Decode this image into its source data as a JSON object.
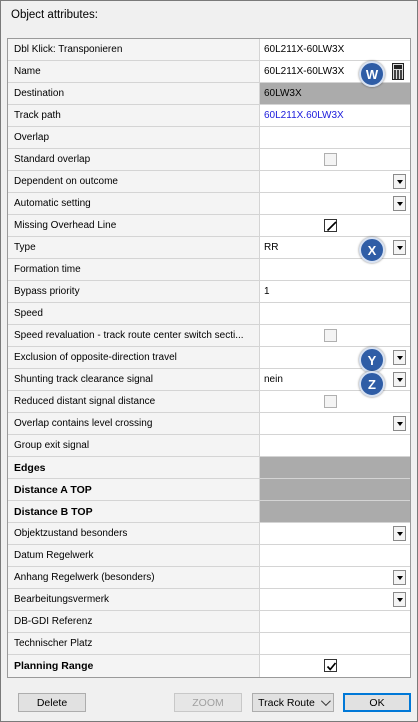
{
  "window": {
    "title": "Object attributes:"
  },
  "rows": [
    {
      "label": "Dbl Klick: Transponieren",
      "value": "60L211X-60LW3X"
    },
    {
      "label": "Name",
      "value": "60L211X-60LW3X"
    },
    {
      "label": "Destination",
      "value": "60LW3X"
    },
    {
      "label": "Track path",
      "value": "60L211X.60LW3X"
    },
    {
      "label": "Overlap",
      "value": ""
    },
    {
      "label": "Standard overlap",
      "value": ""
    },
    {
      "label": "Dependent on outcome",
      "value": ""
    },
    {
      "label": "Automatic setting",
      "value": ""
    },
    {
      "label": "Missing Overhead Line",
      "value": ""
    },
    {
      "label": "Type",
      "value": "RR"
    },
    {
      "label": "Formation time",
      "value": ""
    },
    {
      "label": "Bypass priority",
      "value": "1"
    },
    {
      "label": "Speed",
      "value": ""
    },
    {
      "label": "Speed revaluation - track route center switch secti...",
      "value": ""
    },
    {
      "label": "Exclusion of opposite-direction travel",
      "value": ""
    },
    {
      "label": "Shunting track clearance signal",
      "value": "nein"
    },
    {
      "label": "Reduced distant signal distance",
      "value": ""
    },
    {
      "label": "Overlap contains level crossing",
      "value": ""
    },
    {
      "label": "Group exit signal",
      "value": ""
    },
    {
      "label": "Edges",
      "value": ""
    },
    {
      "label": "Distance A TOP",
      "value": ""
    },
    {
      "label": "Distance B TOP",
      "value": ""
    },
    {
      "label": "Objektzustand besonders",
      "value": ""
    },
    {
      "label": "Datum Regelwerk",
      "value": ""
    },
    {
      "label": "Anhang Regelwerk (besonders)",
      "value": ""
    },
    {
      "label": "Bearbeitungsvermerk",
      "value": ""
    },
    {
      "label": "DB-GDI Referenz",
      "value": ""
    },
    {
      "label": "Technischer Platz",
      "value": ""
    },
    {
      "label": "Planning Range",
      "value": ""
    }
  ],
  "markers": {
    "w": "W",
    "x": "X",
    "y": "Y",
    "z": "Z"
  },
  "buttons": {
    "delete": "Delete",
    "zoom": "ZOOM",
    "track_route": "Track Route",
    "ok": "OK"
  },
  "colors": {
    "marker": "#2f5da6",
    "gray_cell": "#ababab",
    "link_text": "#1a1adc",
    "ok_border": "#0078d7"
  }
}
